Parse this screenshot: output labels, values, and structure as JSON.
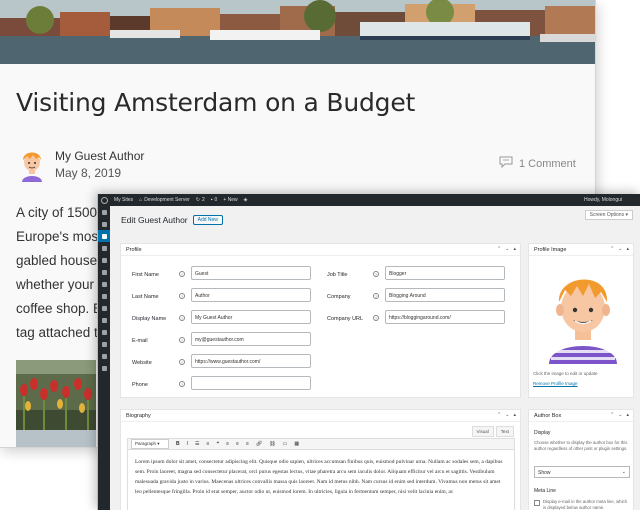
{
  "blog": {
    "title": "Visiting Amsterdam on a Budget",
    "author": "My Guest Author",
    "date": "May 8, 2019",
    "comments": "1 Comment",
    "excerpt_lines": [
      "A city of 1500",
      "Europe's most",
      "gabled house",
      "whether your",
      "coffee shop. E",
      "tag attached t"
    ]
  },
  "adminbar": {
    "site": "My Sites",
    "server": "Development Server",
    "updates": "2",
    "comments": "0",
    "new": "+ New",
    "howdy": "Howdy, Molongui"
  },
  "screen_options": "Screen Options ▾",
  "page": {
    "heading": "Edit Guest Author",
    "add_new": "Add New"
  },
  "profile": {
    "title": "Profile",
    "fields": {
      "first_name": {
        "label": "First Name",
        "value": "Guest"
      },
      "last_name": {
        "label": "Last Name",
        "value": "Author"
      },
      "display_name": {
        "label": "Display Name",
        "value": "My Guest Author"
      },
      "email": {
        "label": "E-mail",
        "value": "my@guestauthor.com"
      },
      "website": {
        "label": "Website",
        "value": "https://www.guestauthor.com/"
      },
      "phone": {
        "label": "Phone",
        "value": ""
      },
      "job_title": {
        "label": "Job Title",
        "value": "Blogger"
      },
      "company": {
        "label": "Company",
        "value": "Blogging Around"
      },
      "company_url": {
        "label": "Company URL",
        "value": "https://bloggingaround.com/"
      }
    }
  },
  "profile_image": {
    "title": "Profile Image",
    "note": "Click the image to edit or update",
    "remove": "Remove Profile Image"
  },
  "biography": {
    "title": "Biography",
    "tab_visual": "Visual",
    "tab_text": "Text",
    "format": "Paragraph",
    "text": "Lorem ipsum dolor sit amet, consectetur adipiscing elit. Quisque odio sapien, ultrices accumsan finibus quis, euismod pulvinar urna. Nullam ac sodales sem, a dapibus sem. Proin laoreet, magna sed consectetur placerat, orci purus egestas lectus, vitae pharetra arcu sem iaculis dolor. Aliquam efficitur vel arcu et sagittis. Vestibulum malesuada gravida justo in varius. Maecenas ultrices convallis massa quis laoreet. Nam id metus nibh. Nam cursus id enim sed interdum. Vivamus non metus sit amet leo pellentesque fringilla. Proin id erat semper, auctor odio ut, euismod lorem. In ultricies, ligula in fermentum semper, nisi velit lacinia enim, ac"
  },
  "author_box": {
    "title": "Author Box",
    "display_label": "Display",
    "display_help": "Choose whether to display the author box for this author regardless of other post or plugin settings.",
    "display_value": "Show",
    "metaline_label": "Meta Line",
    "metaline_text": "Display e-mail in the author meta line, which is displayed below author name."
  },
  "colors": {
    "admin_bar": "#23282d",
    "accent": "#0073aa"
  }
}
